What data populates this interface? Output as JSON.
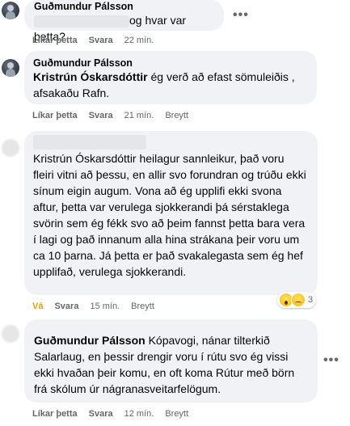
{
  "comments": [
    {
      "author": "Guðmundur Pálsson",
      "text": "og hvar var þetta?",
      "actions": {
        "like": "Líkar þetta",
        "reply": "Svara",
        "time": "22 mín."
      },
      "more": "•••"
    },
    {
      "author": "Guðmundur Pálsson",
      "mention": "Kristrún Óskarsdóttir",
      "text": " ég verð að efast sömuleiðis , afsakaðu Rafn.",
      "actions": {
        "like": "Líkar þetta",
        "reply": "Svara",
        "time": "21 mín.",
        "edited": "Breytt"
      },
      "more": "•••"
    },
    {
      "text": "Kristrún Óskarsdóttir heilagur sannleikur, það voru fleiri vitni að þessu, en allir svo forundran og trúðu ekki sínum eigin augum. Vona að ég upplifi ekki svona aftur, þetta var verulega sjokkerandi þá sérstaklega svörin sem ég fékk svo að þeim fannst þetta bara vera í lagi og það innanum alla hina strákana þeir voru um ca 10 þarna. Já þetta er það svakalegasta sem ég hef upplifað, verulega sjokkerandi.",
      "actions": {
        "like": "Vá",
        "reply": "Svara",
        "time": "15 mín.",
        "edited": "Breytt"
      },
      "reactions": {
        "icons": [
          "wow-emoji-icon",
          "sad-emoji-icon"
        ],
        "count": "3",
        "colors": {
          "emoji": "#f7c423"
        }
      }
    },
    {
      "author": "Guðmundur Pálsson",
      "text": " Kópavogi, nánar tilterkið Salarlaug, en þessir drengir voru í rútu svo ég vissi ekki hvaðan þeir komu, en oft koma Rútur með börn frá skólum úr nágranasveitarfelögum.",
      "actions": {
        "like": "Líkar þetta",
        "reply": "Svara",
        "time": "12 mín.",
        "edited": "Breytt"
      },
      "more": "•••"
    }
  ],
  "colors": {
    "bubble": "#f0f2f5",
    "meta": "#65676b",
    "liked": "#e3a400"
  }
}
